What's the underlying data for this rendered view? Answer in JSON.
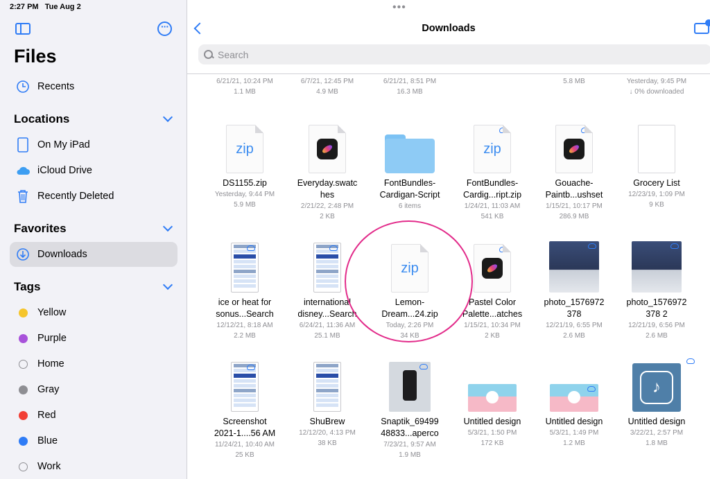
{
  "status": {
    "time": "2:27 PM",
    "date": "Tue Aug 2"
  },
  "sidebar": {
    "title": "Files",
    "recents": "Recents",
    "locations_header": "Locations",
    "locations": [
      "On My iPad",
      "iCloud Drive",
      "Recently Deleted"
    ],
    "favorites_header": "Favorites",
    "favorites": [
      "Downloads"
    ],
    "tags_header": "Tags",
    "tags": [
      {
        "label": "Yellow",
        "color": "#f5c52c"
      },
      {
        "label": "Purple",
        "color": "#a852da"
      },
      {
        "label": "Home",
        "color": ""
      },
      {
        "label": "Gray",
        "color": "#8e8e93"
      },
      {
        "label": "Red",
        "color": "#f23f35"
      },
      {
        "label": "Blue",
        "color": "#2f7cf6"
      },
      {
        "label": "Work",
        "color": ""
      }
    ]
  },
  "header": {
    "title": "Downloads"
  },
  "search": {
    "placeholder": "Search"
  },
  "top_row": [
    {
      "date": "6/21/21, 10:24 PM",
      "size": "1.1 MB"
    },
    {
      "date": "6/7/21, 12:45 PM",
      "size": "4.9 MB"
    },
    {
      "date": "6/21/21, 8:51 PM",
      "size": "16.3 MB"
    },
    {
      "date": "",
      "size": "5.8 MB"
    },
    {
      "date": "Yesterday, 9:45 PM",
      "size": "↓ 0% downloaded"
    }
  ],
  "files": [
    {
      "name": "DS1155.zip",
      "name2": "",
      "date": "Yesterday, 9:44 PM",
      "size": "5.9 MB",
      "thumb": "zip"
    },
    {
      "name": "Everyday.swatc",
      "name2": "hes",
      "date": "2/21/22, 2:48 PM",
      "size": "2 KB",
      "thumb": "procreate"
    },
    {
      "name": "FontBundles-",
      "name2": "Cardigan-Script",
      "date": "6 items",
      "size": "",
      "thumb": "folder"
    },
    {
      "name": "FontBundles-",
      "name2": "Cardig...ript.zip",
      "date": "1/24/21, 11:03 AM",
      "size": "541 KB",
      "thumb": "zip"
    },
    {
      "name": "Gouache-",
      "name2": "Paintb...ushset",
      "date": "1/15/21, 10:17 PM",
      "size": "286.9 MB",
      "thumb": "procreate"
    },
    {
      "name": "Grocery List",
      "name2": "",
      "date": "12/23/19, 1:09 PM",
      "size": "9 KB",
      "thumb": "doc"
    },
    {
      "name": "ice or heat for",
      "name2": "sonus...Search",
      "date": "12/12/21, 8:18 AM",
      "size": "2.2 MB",
      "thumb": "shot"
    },
    {
      "name": "international",
      "name2": "disney...Search",
      "date": "6/24/21, 11:36 AM",
      "size": "25.1 MB",
      "thumb": "shot"
    },
    {
      "name": "Lemon-",
      "name2": "Dream...24.zip",
      "date": "Today, 2:26 PM",
      "size": "34 KB",
      "thumb": "zip"
    },
    {
      "name": "Pastel Color",
      "name2": "Palette...atches",
      "date": "1/15/21, 10:34 PM",
      "size": "2 KB",
      "thumb": "procreate"
    },
    {
      "name": "photo_1576972",
      "name2": "378",
      "date": "12/21/19, 6:55 PM",
      "size": "2.6 MB",
      "thumb": "photo"
    },
    {
      "name": "photo_1576972",
      "name2": "378 2",
      "date": "12/21/19, 6:56 PM",
      "size": "2.6 MB",
      "thumb": "photo"
    },
    {
      "name": "Screenshot",
      "name2": "2021-1....56 AM",
      "date": "11/24/21, 10:40 AM",
      "size": "25 KB",
      "thumb": "shot"
    },
    {
      "name": "ShuBrew",
      "name2": "",
      "date": "12/12/20, 4:13 PM",
      "size": "38 KB",
      "thumb": "shot"
    },
    {
      "name": "Snaptik_69499",
      "name2": "48833...aperco",
      "date": "7/23/21, 9:57 AM",
      "size": "1.9 MB",
      "thumb": "phone"
    },
    {
      "name": "Untitled design",
      "name2": "",
      "date": "5/3/21, 1:50 PM",
      "size": "172 KB",
      "thumb": "banner"
    },
    {
      "name": "Untitled design",
      "name2": "",
      "date": "5/3/21, 1:49 PM",
      "size": "1.2 MB",
      "thumb": "banner"
    },
    {
      "name": "Untitled design",
      "name2": "",
      "date": "3/22/21, 2:57 PM",
      "size": "1.8 MB",
      "thumb": "tiktok"
    }
  ],
  "zip_label": "zip"
}
